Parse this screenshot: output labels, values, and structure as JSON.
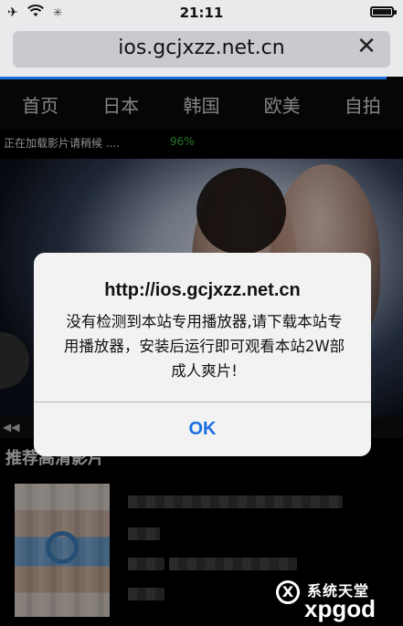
{
  "status_bar": {
    "time": "21:11",
    "icons": [
      "airplane-icon",
      "wifi-icon",
      "loading-spinner-icon",
      "battery-icon"
    ],
    "battery_level": 0.9
  },
  "url_bar": {
    "url": "ios.gcjxzz.net.cn",
    "close_glyph": "✕",
    "load_progress": 0.96
  },
  "nav": {
    "items": [
      "首页",
      "日本",
      "韩国",
      "欧美",
      "自拍"
    ]
  },
  "loading": {
    "text": "正在加载影片请稍候 ....",
    "percent": "96%"
  },
  "section": {
    "title": "推荐高清影片"
  },
  "alert": {
    "title": "http://ios.gcjxzz.net.cn",
    "message": "没有检测到本站专用播放器,请下载本站专用播放器，安装后运行即可观看本站2W部成人爽片!",
    "button": "OK"
  },
  "watermark": {
    "top": "系统天堂",
    "bottom": "xpgod",
    "mark": "X"
  },
  "colors": {
    "accent": "#1a6fe0",
    "loading_percent": "#3fbe3f"
  }
}
